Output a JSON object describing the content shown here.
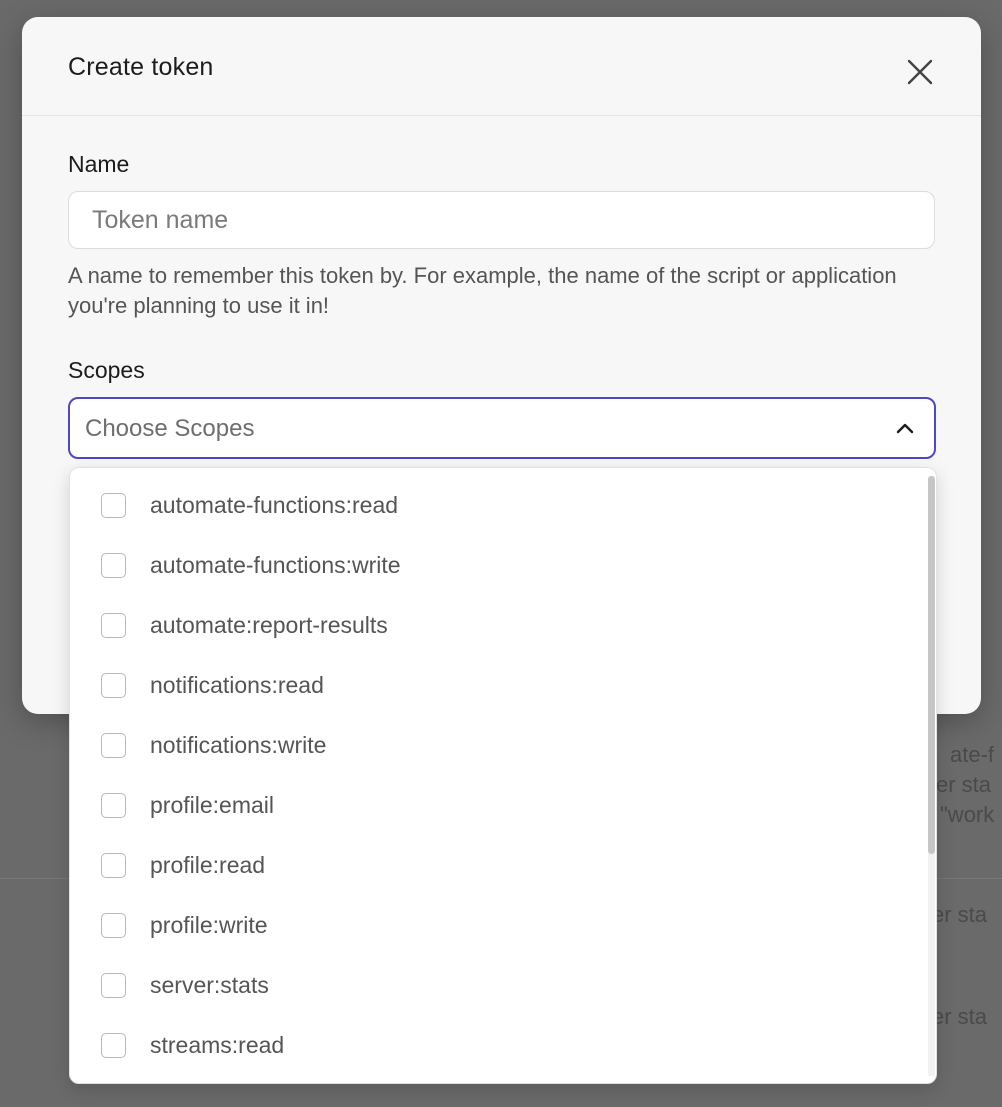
{
  "modal": {
    "title": "Create token",
    "close_icon": "close-icon"
  },
  "name_field": {
    "label": "Name",
    "placeholder": "Token name",
    "value": "",
    "helper": "A name to remember this token by. For example, the name of the script or application you're planning to use it in!"
  },
  "scopes_field": {
    "label": "Scopes",
    "placeholder": "Choose Scopes",
    "chevron_icon": "chevron-up-icon",
    "accent_color": "#4f46c8",
    "options": [
      {
        "label": "automate-functions:read",
        "checked": false
      },
      {
        "label": "automate-functions:write",
        "checked": false
      },
      {
        "label": "automate:report-results",
        "checked": false
      },
      {
        "label": "notifications:read",
        "checked": false
      },
      {
        "label": "notifications:write",
        "checked": false
      },
      {
        "label": "profile:email",
        "checked": false
      },
      {
        "label": "profile:read",
        "checked": false
      },
      {
        "label": "profile:write",
        "checked": false
      },
      {
        "label": "server:stats",
        "checked": false
      },
      {
        "label": "streams:read",
        "checked": false
      }
    ]
  }
}
